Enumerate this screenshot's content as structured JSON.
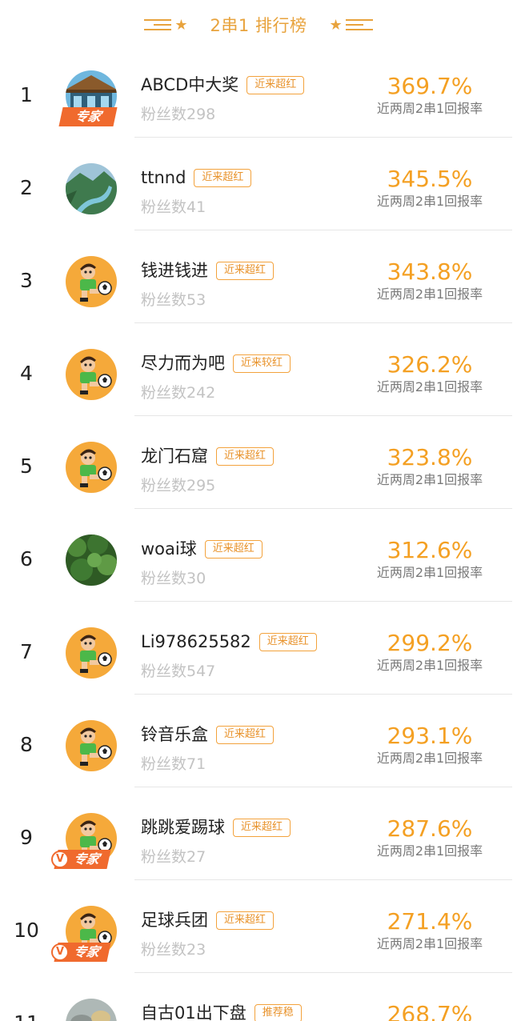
{
  "header": {
    "title": "2串1 排行榜",
    "accent_color": "#e8a33d"
  },
  "colors": {
    "rate": "#f4a023",
    "tag_border": "#f3a23c",
    "expert_badge": "#f06a2e",
    "fans": "#c3c3c3"
  },
  "rows": [
    {
      "rank": "1",
      "name": "ABCD中大奖",
      "tag": "近来超红",
      "fans": "粉丝数298",
      "rate": "369.7%",
      "rate_label": "近两周2串1回报率",
      "avatar": "beach-hut",
      "badge": "专家",
      "badge_v": false
    },
    {
      "rank": "2",
      "name": "ttnnd",
      "tag": "近来超红",
      "fans": "粉丝数41",
      "rate": "345.5%",
      "rate_label": "近两周2串1回报率",
      "avatar": "river-valley",
      "badge": "",
      "badge_v": false
    },
    {
      "rank": "3",
      "name": "钱进钱进",
      "tag": "近来超红",
      "fans": "粉丝数53",
      "rate": "343.8%",
      "rate_label": "近两周2串1回报率",
      "avatar": "soccer-player",
      "badge": "",
      "badge_v": false
    },
    {
      "rank": "4",
      "name": "尽力而为吧",
      "tag": "近来较红",
      "fans": "粉丝数242",
      "rate": "326.2%",
      "rate_label": "近两周2串1回报率",
      "avatar": "soccer-player",
      "badge": "",
      "badge_v": false
    },
    {
      "rank": "5",
      "name": "龙门石窟",
      "tag": "近来超红",
      "fans": "粉丝数295",
      "rate": "323.8%",
      "rate_label": "近两周2串1回报率",
      "avatar": "soccer-player",
      "badge": "",
      "badge_v": false
    },
    {
      "rank": "6",
      "name": "woai球",
      "tag": "近来超红",
      "fans": "粉丝数30",
      "rate": "312.6%",
      "rate_label": "近两周2串1回报率",
      "avatar": "forest",
      "badge": "",
      "badge_v": false
    },
    {
      "rank": "7",
      "name": "Li978625582",
      "tag": "近来超红",
      "fans": "粉丝数547",
      "rate": "299.2%",
      "rate_label": "近两周2串1回报率",
      "avatar": "soccer-player",
      "badge": "",
      "badge_v": false
    },
    {
      "rank": "8",
      "name": "铃音乐盒",
      "tag": "近来超红",
      "fans": "粉丝数71",
      "rate": "293.1%",
      "rate_label": "近两周2串1回报率",
      "avatar": "soccer-player",
      "badge": "",
      "badge_v": false
    },
    {
      "rank": "9",
      "name": "跳跳爱踢球",
      "tag": "近来超红",
      "fans": "粉丝数27",
      "rate": "287.6%",
      "rate_label": "近两周2串1回报率",
      "avatar": "soccer-player",
      "badge": "专家",
      "badge_v": true
    },
    {
      "rank": "10",
      "name": "足球兵团",
      "tag": "近来超红",
      "fans": "粉丝数23",
      "rate": "271.4%",
      "rate_label": "近两周2串1回报率",
      "avatar": "soccer-player",
      "badge": "专家",
      "badge_v": true
    },
    {
      "rank": "11",
      "name": "自古01出下盘",
      "tag": "推荐稳",
      "fans": "",
      "rate": "268.7%",
      "rate_label": "",
      "avatar": "rocks",
      "badge": "",
      "badge_v": false
    }
  ]
}
